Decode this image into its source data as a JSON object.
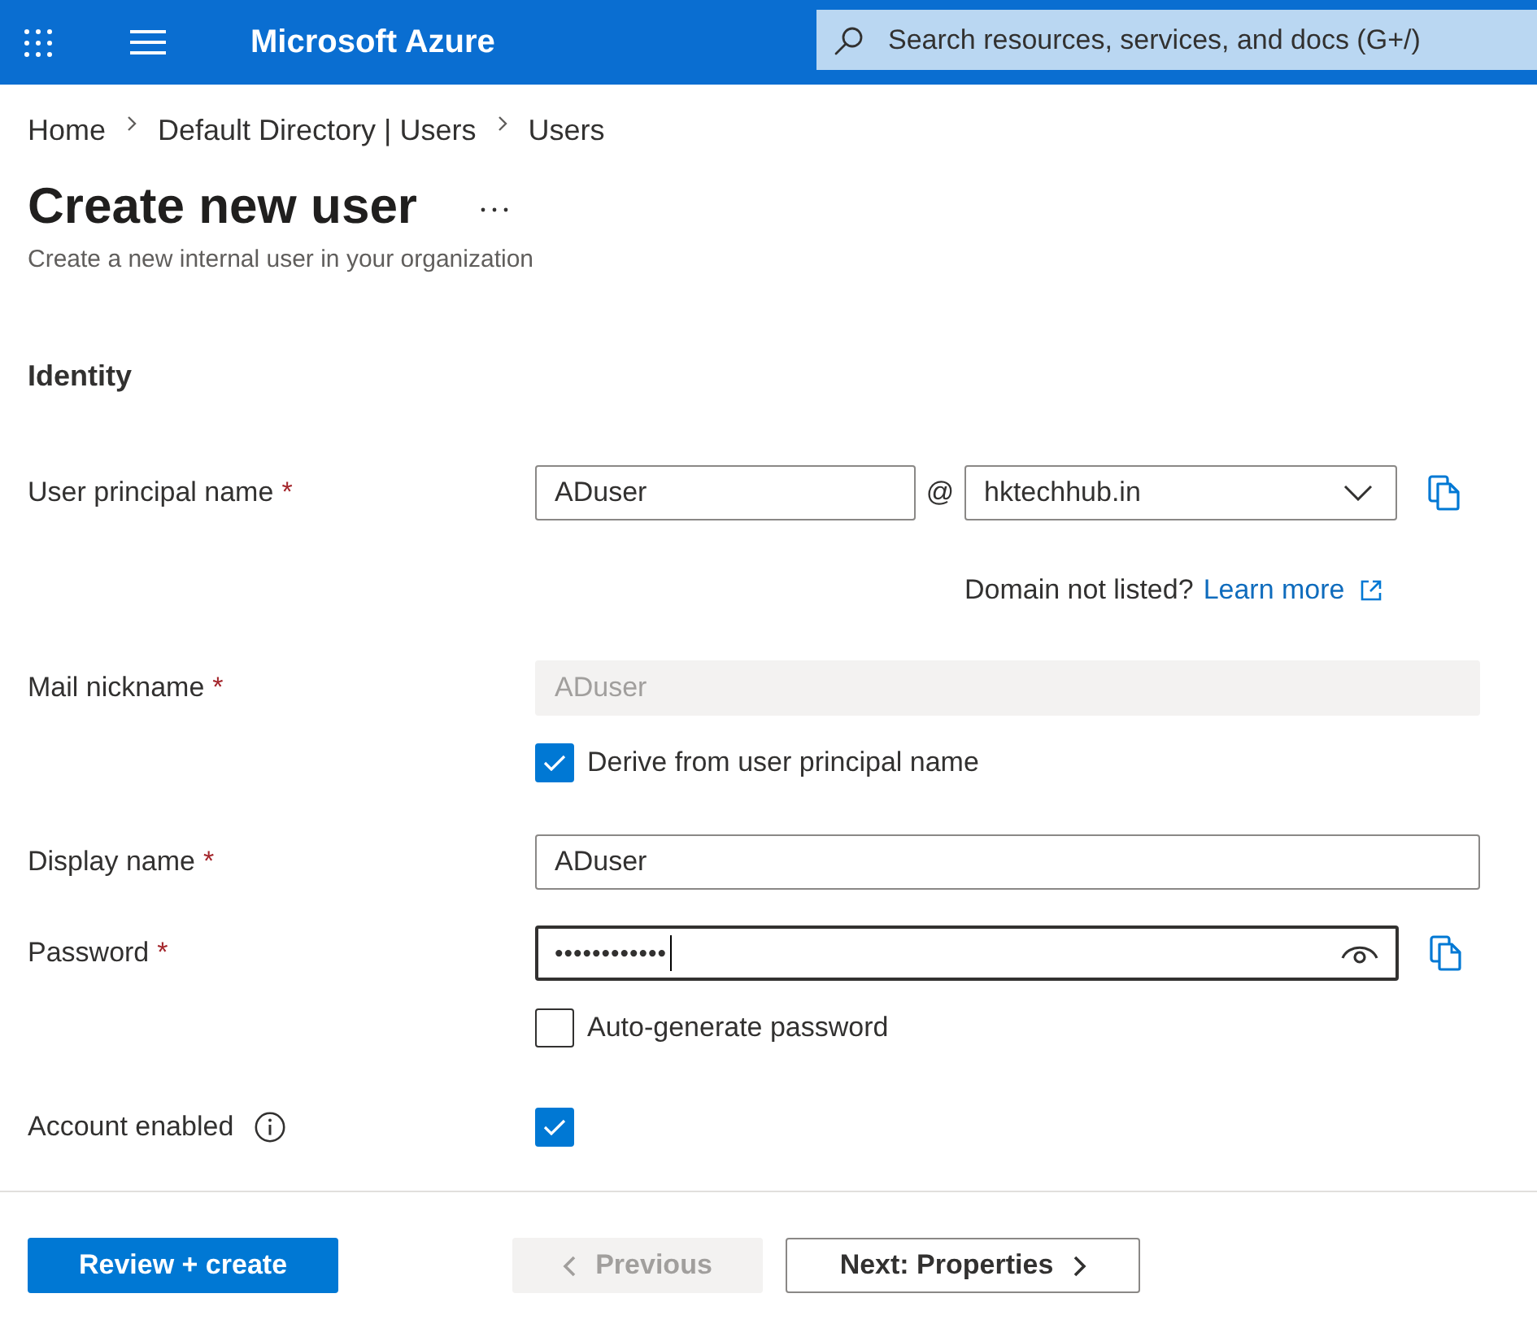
{
  "topbar": {
    "title": "Microsoft Azure",
    "search": {
      "placeholder": "Search resources, services, and docs (G+/)"
    }
  },
  "breadcrumb": [
    {
      "label": "Home"
    },
    {
      "label": "Default Directory | Users"
    },
    {
      "label": "Users"
    }
  ],
  "header": {
    "title": "Create new user",
    "subtitle": "Create a new internal user in your organization"
  },
  "section": {
    "title": "Identity",
    "rows": [
      {
        "kind": "principal",
        "label": "User principal name",
        "required_mark": "*",
        "value": "ADuser",
        "separator": "@",
        "domain": "hktechhub.in",
        "note": "Domain not listed?",
        "link": "Learn more"
      },
      {
        "kind": "text",
        "label": "Mail nickname",
        "required_mark": "*",
        "value": "ADuser",
        "disabled": true,
        "option": {
          "label": "Derive from user principal name",
          "checked": true
        }
      },
      {
        "kind": "text",
        "label": "Display name",
        "required_mark": "*",
        "value": "ADuser",
        "disabled": false
      },
      {
        "kind": "password",
        "label": "Password",
        "required_mark": "*",
        "value": "••••••••••••",
        "focused": true,
        "option": {
          "label": "Auto-generate password",
          "checked": false
        }
      },
      {
        "kind": "checkbox",
        "label": "Account enabled",
        "info": true,
        "checked": true
      }
    ]
  },
  "footer": {
    "buttons": [
      {
        "kind": "primary",
        "label": "Review + create",
        "disabled": false
      },
      {
        "kind": "back",
        "label": "Previous",
        "disabled": true
      },
      {
        "kind": "next",
        "label": "Next: Properties",
        "disabled": false
      }
    ]
  }
}
